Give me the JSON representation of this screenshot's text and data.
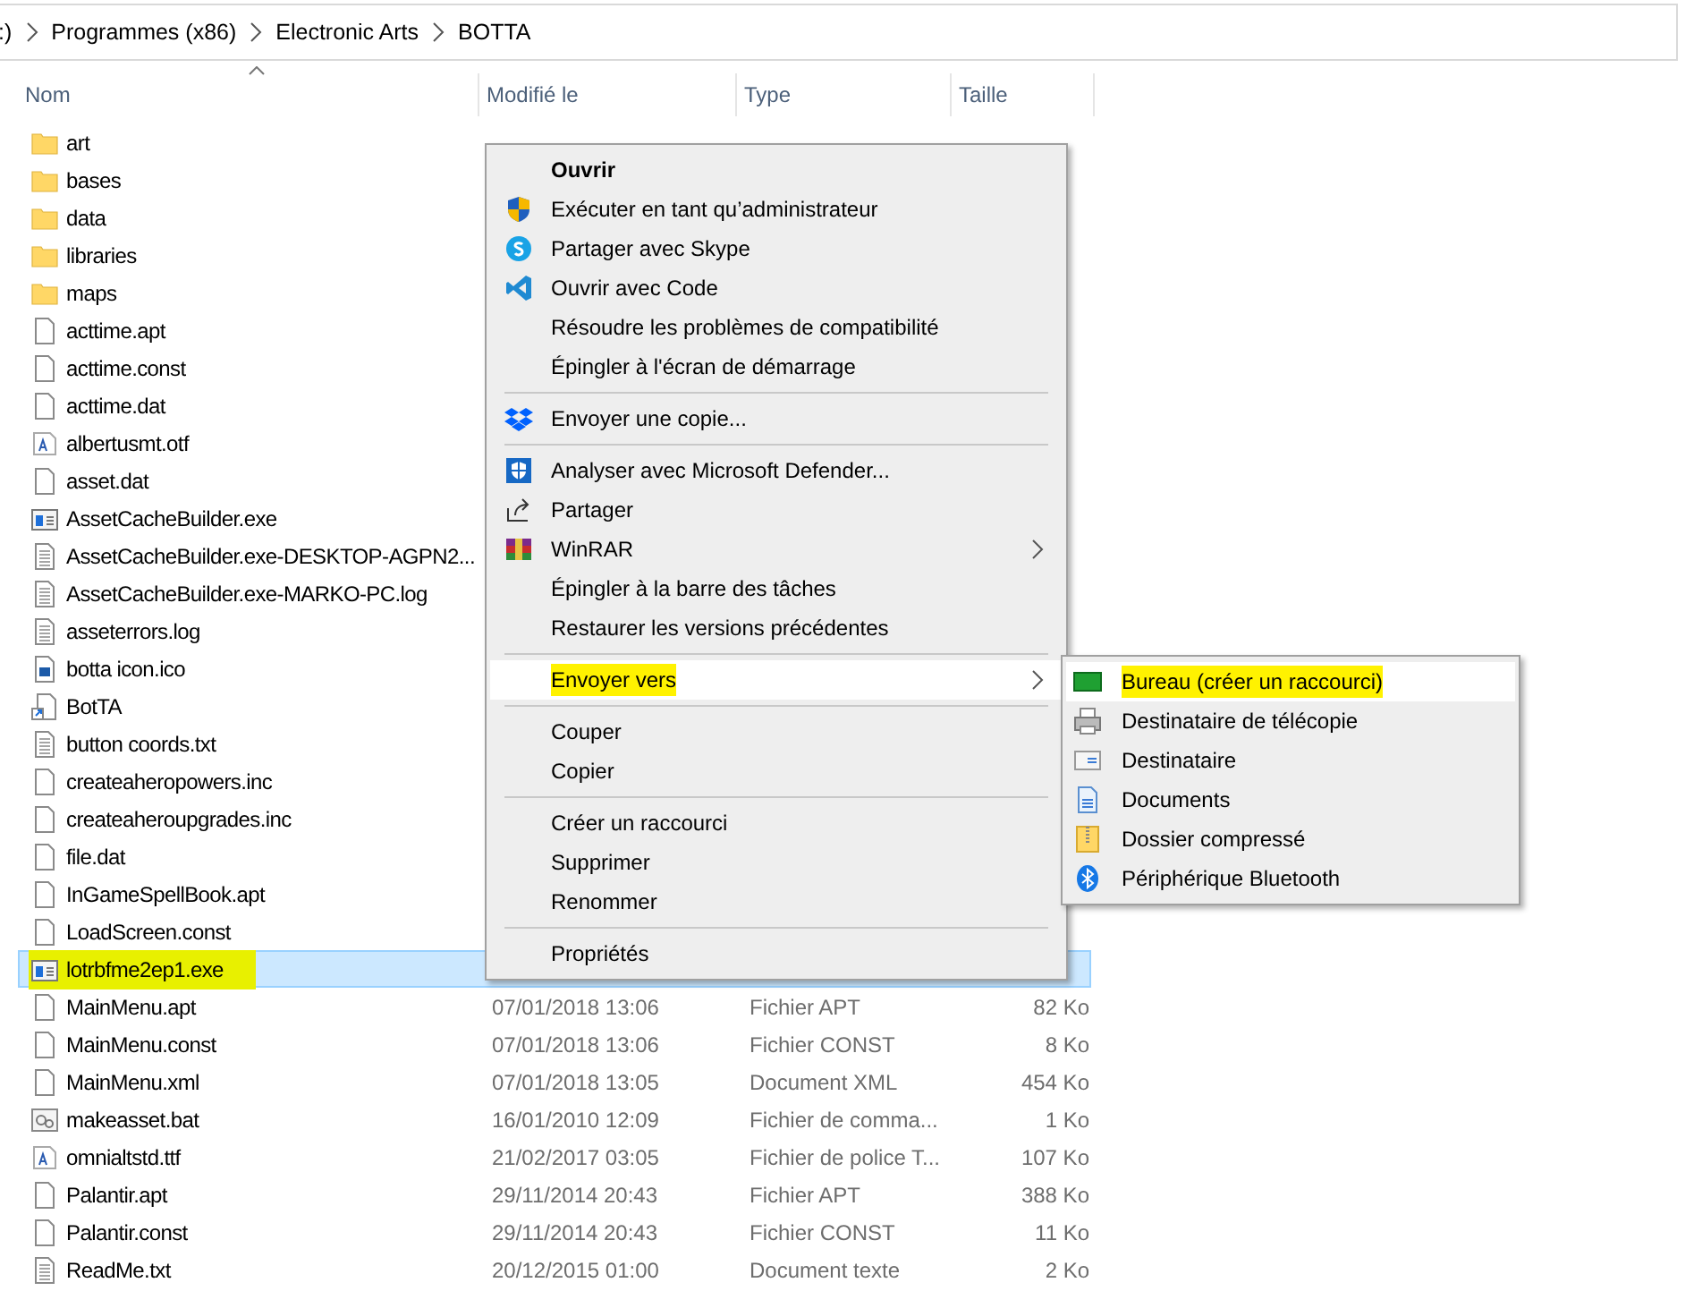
{
  "address": {
    "path": [
      ":)",
      "Programmes (x86)",
      "Electronic Arts",
      "BOTTA"
    ]
  },
  "columns": [
    {
      "label": "Nom",
      "sorted": true
    },
    {
      "label": "Modifié le",
      "sorted": false
    },
    {
      "label": "Type",
      "sorted": false
    },
    {
      "label": "Taille",
      "sorted": false
    }
  ],
  "files": [
    {
      "name": "art",
      "kind": "folder",
      "selected": false,
      "highlighted": false
    },
    {
      "name": "bases",
      "kind": "folder",
      "selected": false,
      "highlighted": false
    },
    {
      "name": "data",
      "kind": "folder",
      "selected": false,
      "highlighted": false
    },
    {
      "name": "libraries",
      "kind": "folder",
      "selected": false,
      "highlighted": false
    },
    {
      "name": "maps",
      "kind": "folder",
      "selected": false,
      "highlighted": false
    },
    {
      "name": "acttime.apt",
      "kind": "file",
      "selected": false,
      "highlighted": false
    },
    {
      "name": "acttime.const",
      "kind": "file",
      "selected": false,
      "highlighted": false
    },
    {
      "name": "acttime.dat",
      "kind": "file",
      "selected": false,
      "highlighted": false
    },
    {
      "name": "albertusmt.otf",
      "kind": "font",
      "selected": false,
      "highlighted": false
    },
    {
      "name": "asset.dat",
      "kind": "file",
      "selected": false,
      "highlighted": false
    },
    {
      "name": "AssetCacheBuilder.exe",
      "kind": "exe",
      "selected": false,
      "highlighted": false
    },
    {
      "name": "AssetCacheBuilder.exe-DESKTOP-AGPN2...",
      "kind": "text",
      "selected": false,
      "highlighted": false
    },
    {
      "name": "AssetCacheBuilder.exe-MARKO-PC.log",
      "kind": "text",
      "selected": false,
      "highlighted": false
    },
    {
      "name": "asseterrors.log",
      "kind": "text",
      "selected": false,
      "highlighted": false
    },
    {
      "name": "botta icon.ico",
      "kind": "image",
      "selected": false,
      "highlighted": false
    },
    {
      "name": "BotTA",
      "kind": "shortcut",
      "selected": false,
      "highlighted": false
    },
    {
      "name": "button coords.txt",
      "kind": "text",
      "selected": false,
      "highlighted": false
    },
    {
      "name": "createaheropowers.inc",
      "kind": "file",
      "selected": false,
      "highlighted": false
    },
    {
      "name": "createaheroupgrades.inc",
      "kind": "file",
      "selected": false,
      "highlighted": false
    },
    {
      "name": "file.dat",
      "kind": "file",
      "selected": false,
      "highlighted": false
    },
    {
      "name": "InGameSpellBook.apt",
      "kind": "file",
      "selected": false,
      "highlighted": false
    },
    {
      "name": "LoadScreen.const",
      "kind": "file",
      "selected": false,
      "highlighted": false
    },
    {
      "name": "lotrbfme2ep1.exe",
      "kind": "exe",
      "selected": true,
      "highlighted": true
    },
    {
      "name": "MainMenu.apt",
      "kind": "file",
      "selected": false,
      "highlighted": false,
      "modified": "07/01/2018 13:06",
      "type": "Fichier APT",
      "size": "82 Ko"
    },
    {
      "name": "MainMenu.const",
      "kind": "file",
      "selected": false,
      "highlighted": false,
      "modified": "07/01/2018 13:06",
      "type": "Fichier CONST",
      "size": "8 Ko"
    },
    {
      "name": "MainMenu.xml",
      "kind": "file",
      "selected": false,
      "highlighted": false,
      "modified": "07/01/2018 13:05",
      "type": "Document XML",
      "size": "454 Ko"
    },
    {
      "name": "makeasset.bat",
      "kind": "bat",
      "selected": false,
      "highlighted": false,
      "modified": "16/01/2010 12:09",
      "type": "Fichier de comma...",
      "size": "1 Ko"
    },
    {
      "name": "omnialtstd.ttf",
      "kind": "font",
      "selected": false,
      "highlighted": false,
      "modified": "21/02/2017 03:05",
      "type": "Fichier de police T...",
      "size": "107 Ko"
    },
    {
      "name": "Palantir.apt",
      "kind": "file",
      "selected": false,
      "highlighted": false,
      "modified": "29/11/2014 20:43",
      "type": "Fichier APT",
      "size": "388 Ko"
    },
    {
      "name": "Palantir.const",
      "kind": "file",
      "selected": false,
      "highlighted": false,
      "modified": "29/11/2014 20:43",
      "type": "Fichier CONST",
      "size": "11 Ko"
    },
    {
      "name": "ReadMe.txt",
      "kind": "text",
      "selected": false,
      "highlighted": false,
      "modified": "20/12/2015 01:00",
      "type": "Document texte",
      "size": "2 Ko"
    }
  ],
  "context_menu": {
    "items": [
      {
        "kind": "plain",
        "label": "Ouvrir",
        "default": true,
        "submenu": false,
        "selected": false,
        "highlighted": false
      },
      {
        "kind": "shield",
        "label": "Exécuter en tant qu’administrateur",
        "default": false,
        "submenu": false,
        "selected": false,
        "highlighted": false
      },
      {
        "kind": "skype",
        "label": "Partager avec Skype",
        "default": false,
        "submenu": false,
        "selected": false,
        "highlighted": false
      },
      {
        "kind": "code",
        "label": "Ouvrir avec Code",
        "default": false,
        "submenu": false,
        "selected": false,
        "highlighted": false
      },
      {
        "kind": "plain",
        "label": "Résoudre les problèmes de compatibilité",
        "default": false,
        "submenu": false,
        "selected": false,
        "highlighted": false
      },
      {
        "kind": "plain",
        "label": "Épingler à l'écran de démarrage",
        "default": false,
        "submenu": false,
        "selected": false,
        "highlighted": false
      },
      {
        "kind": "separator"
      },
      {
        "kind": "dropbox",
        "label": "Envoyer une copie...",
        "default": false,
        "submenu": false,
        "selected": false,
        "highlighted": false
      },
      {
        "kind": "separator"
      },
      {
        "kind": "defender",
        "label": "Analyser avec Microsoft Defender...",
        "default": false,
        "submenu": false,
        "selected": false,
        "highlighted": false
      },
      {
        "kind": "share",
        "label": "Partager",
        "default": false,
        "submenu": false,
        "selected": false,
        "highlighted": false
      },
      {
        "kind": "winrar",
        "label": "WinRAR",
        "default": false,
        "submenu": true,
        "selected": false,
        "highlighted": false
      },
      {
        "kind": "plain",
        "label": "Épingler à la barre des tâches",
        "default": false,
        "submenu": false,
        "selected": false,
        "highlighted": false
      },
      {
        "kind": "plain",
        "label": "Restaurer les versions précédentes",
        "default": false,
        "submenu": false,
        "selected": false,
        "highlighted": false
      },
      {
        "kind": "separator"
      },
      {
        "kind": "plain",
        "label": "Envoyer vers",
        "default": false,
        "submenu": true,
        "selected": true,
        "highlighted": true
      },
      {
        "kind": "separator"
      },
      {
        "kind": "plain",
        "label": "Couper",
        "default": false,
        "submenu": false,
        "selected": false,
        "highlighted": false
      },
      {
        "kind": "plain",
        "label": "Copier",
        "default": false,
        "submenu": false,
        "selected": false,
        "highlighted": false
      },
      {
        "kind": "separator"
      },
      {
        "kind": "plain",
        "label": "Créer un raccourci",
        "default": false,
        "submenu": false,
        "selected": false,
        "highlighted": false
      },
      {
        "kind": "plain",
        "label": "Supprimer",
        "default": false,
        "submenu": false,
        "selected": false,
        "highlighted": false
      },
      {
        "kind": "plain",
        "label": "Renommer",
        "default": false,
        "submenu": false,
        "selected": false,
        "highlighted": false
      },
      {
        "kind": "separator"
      },
      {
        "kind": "plain",
        "label": "Propriétés",
        "default": false,
        "submenu": false,
        "selected": false,
        "highlighted": false
      }
    ]
  },
  "send_to_menu": {
    "items": [
      {
        "kind": "desktop",
        "label": "Bureau (créer un raccourci)",
        "selected": true,
        "highlighted": true
      },
      {
        "kind": "fax",
        "label": "Destinataire de télécopie",
        "selected": false,
        "highlighted": false
      },
      {
        "kind": "mail",
        "label": "Destinataire",
        "selected": false,
        "highlighted": false
      },
      {
        "kind": "documents",
        "label": "Documents",
        "selected": false,
        "highlighted": false
      },
      {
        "kind": "zip",
        "label": "Dossier compressé",
        "selected": false,
        "highlighted": false
      },
      {
        "kind": "bluetooth",
        "label": "Périphérique Bluetooth",
        "selected": false,
        "highlighted": false
      }
    ]
  }
}
